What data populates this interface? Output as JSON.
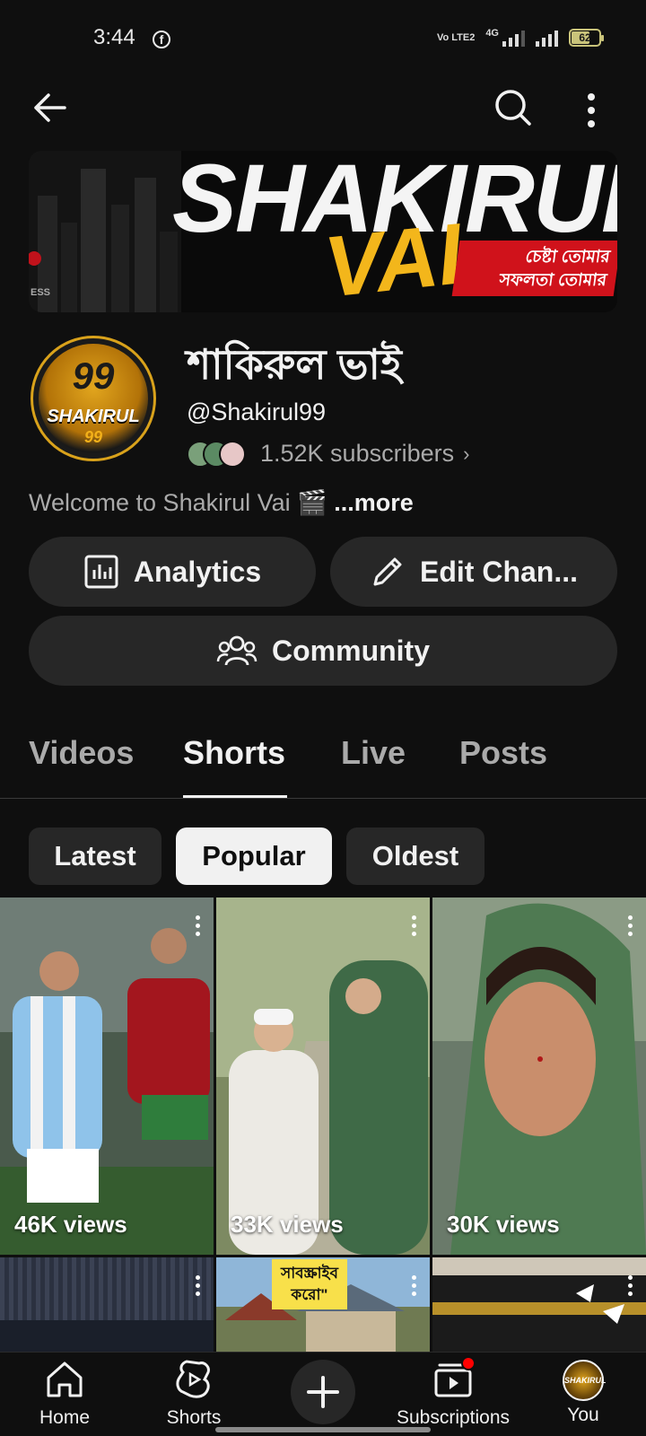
{
  "status_bar": {
    "time": "3:44",
    "network_label": "4G",
    "volte_label": "Vo LTE2",
    "battery": "62"
  },
  "banner": {
    "title": "SHAKIRUL",
    "subtitle": "VAI",
    "tagline_line1": "চেষ্টা তোমার",
    "tagline_line2": "সফলতা তোমার",
    "corner_text": "ESS"
  },
  "channel": {
    "avatar_number": "99",
    "avatar_name": "SHAKIRUL",
    "name": "শাকিরুল ভাই",
    "handle": "@Shakirul99",
    "subscribers": "1.52K subscribers",
    "description": "Welcome to Shakirul Vai 🎬 ",
    "more_label": "...more"
  },
  "actions": {
    "analytics_label": "Analytics",
    "edit_label": "Edit Chan...",
    "community_label": "Community"
  },
  "tabs": [
    {
      "label": "Videos",
      "active": false
    },
    {
      "label": "Shorts",
      "active": true
    },
    {
      "label": "Live",
      "active": false
    },
    {
      "label": "Posts",
      "active": false
    }
  ],
  "filters": [
    {
      "label": "Latest",
      "selected": false
    },
    {
      "label": "Popular",
      "selected": true
    },
    {
      "label": "Oldest",
      "selected": false
    }
  ],
  "shorts": [
    {
      "views": "46K views"
    },
    {
      "views": "33K views"
    },
    {
      "views": "30K views"
    },
    {
      "views": ""
    },
    {
      "views": "",
      "caption_line1": "সাবস্ক্রাইব",
      "caption_line2": "করো\""
    },
    {
      "views": ""
    }
  ],
  "bottom_nav": {
    "home": "Home",
    "shorts": "Shorts",
    "subscriptions": "Subscriptions",
    "you": "You",
    "you_avatar_text": "SHAKIRUL"
  },
  "colors": {
    "background": "#0f0f0f",
    "surface": "#272727",
    "text_primary": "#f1f1f1",
    "text_secondary": "#aaaaaa",
    "accent_red": "#ff0000",
    "brand_gold": "#f3b61b"
  }
}
